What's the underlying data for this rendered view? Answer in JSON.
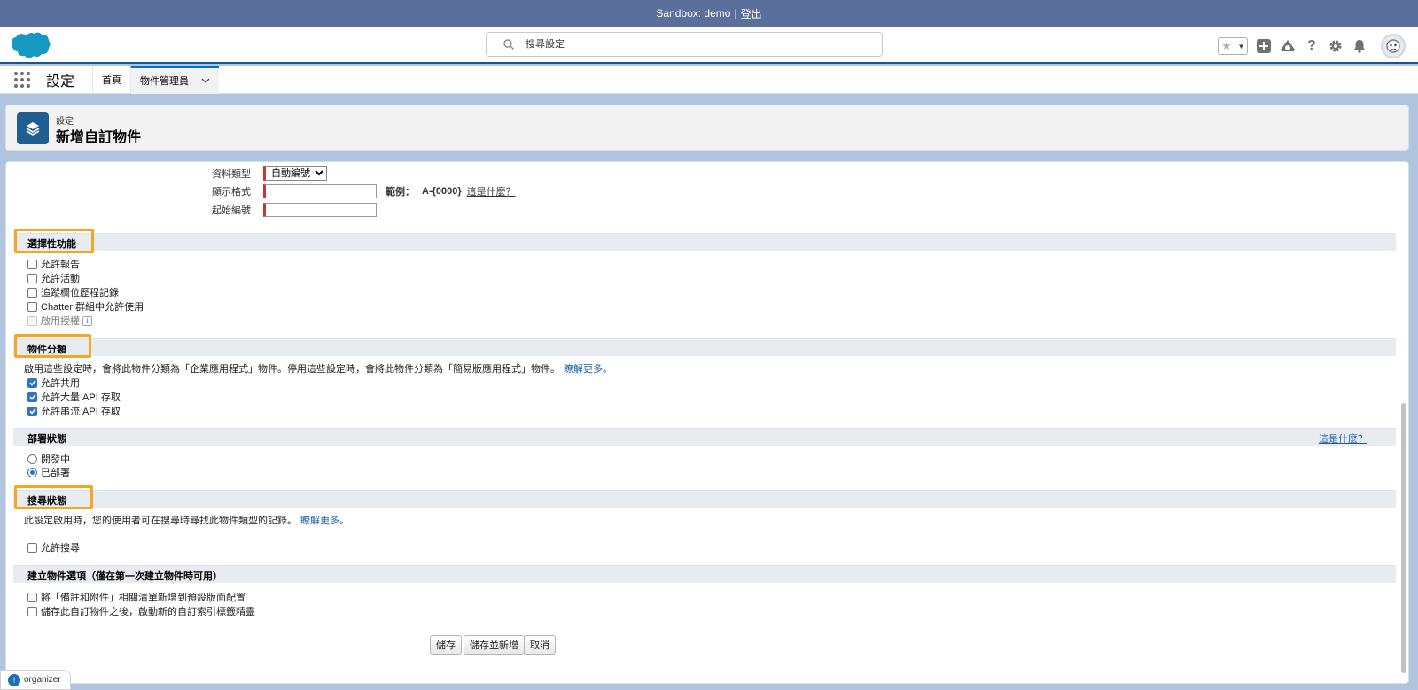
{
  "sandbox": {
    "label": "Sandbox: demo",
    "separator": "|",
    "logout": "登出"
  },
  "header": {
    "search_placeholder": "搜尋設定"
  },
  "nav": {
    "app_name": "設定",
    "tabs": [
      {
        "label": "首頁"
      },
      {
        "label": "物件管理員"
      }
    ]
  },
  "page": {
    "breadcrumb": "設定",
    "title": "新增自訂物件"
  },
  "fields": {
    "data_type": {
      "label": "資料類型",
      "value": "自動編號"
    },
    "display_format": {
      "label": "顯示格式",
      "value": "",
      "example_label": "範例：",
      "example_value": "A-{0000}",
      "help_link": "這是什麼？"
    },
    "start_number": {
      "label": "起始編號",
      "value": ""
    }
  },
  "optional_features": {
    "title": "選擇性功能",
    "items": [
      {
        "label": "允許報告",
        "checked": false
      },
      {
        "label": "允許活動",
        "checked": false
      },
      {
        "label": "追蹤欄位歷程記錄",
        "checked": false
      },
      {
        "label": "Chatter 群組中允許使用",
        "checked": false
      },
      {
        "label": "啟用授權",
        "checked": false,
        "disabled": true
      }
    ]
  },
  "object_classification": {
    "title": "物件分類",
    "description": "啟用這些設定時，會將此物件分類為「企業應用程式」物件。停用這些設定時，會將此物件分類為「簡易版應用程式」物件。",
    "learn_more": "瞭解更多。",
    "items": [
      {
        "label": "允許共用",
        "checked": true
      },
      {
        "label": "允許大量 API 存取",
        "checked": true
      },
      {
        "label": "允許串流 API 存取",
        "checked": true
      }
    ]
  },
  "deployment_status": {
    "title": "部署狀態",
    "help_link": "這是什麼？",
    "options": [
      {
        "label": "開發中",
        "selected": false
      },
      {
        "label": "已部署",
        "selected": true
      }
    ]
  },
  "search_status": {
    "title": "搜尋狀態",
    "description": "此設定啟用時，您的使用者可在搜尋時尋找此物件類型的記錄。",
    "learn_more": "瞭解更多。",
    "items": [
      {
        "label": "允許搜尋",
        "checked": false
      }
    ]
  },
  "create_options": {
    "title": "建立物件選項（僅在第一次建立物件時可用）",
    "items": [
      {
        "label": "將「備註和附件」相關清單新增到預設版面配置",
        "checked": false
      },
      {
        "label": "儲存此自訂物件之後，啟動新的自訂索引標籤精靈",
        "checked": false
      }
    ]
  },
  "buttons": {
    "save": "儲存",
    "save_new": "儲存並新增",
    "cancel": "取消"
  },
  "organizer": {
    "label": "organizer"
  },
  "colors": {
    "highlight": "#f5a623",
    "brand_blue": "#0070d2",
    "sandbox_bar": "#5b6f9c"
  }
}
